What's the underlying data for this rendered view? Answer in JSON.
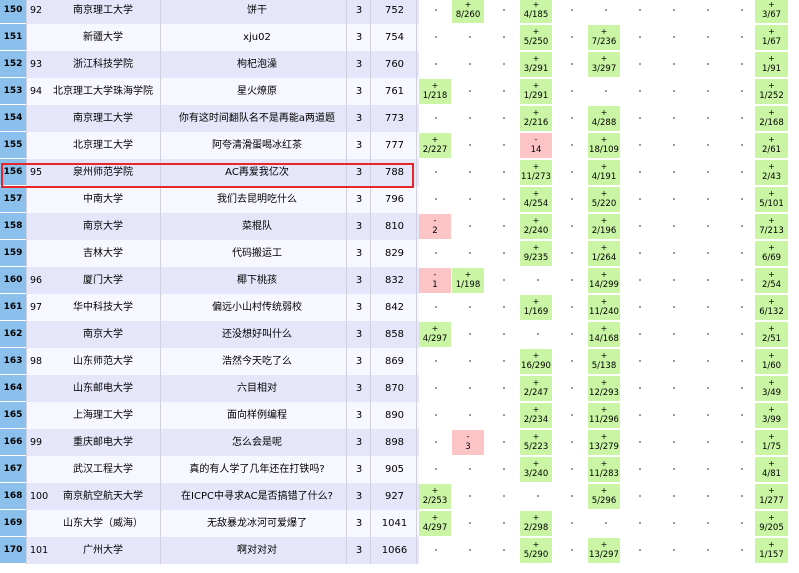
{
  "columns": 15,
  "rows": [
    {
      "rank": "150",
      "school_rank": "92",
      "school": "南京理工大学",
      "team": "饼干",
      "solved": "3",
      "penalty": "752",
      "cells": [
        {
          "c": 1,
          "t": "ac",
          "v": "8/260"
        },
        {
          "c": 3,
          "t": "ac",
          "v": "4/185"
        },
        {
          "c": 14,
          "t": "ac",
          "v": "3/67"
        }
      ]
    },
    {
      "rank": "151",
      "school_rank": "",
      "school": "新疆大学",
      "team": "xju02",
      "solved": "3",
      "penalty": "754",
      "cells": [
        {
          "c": 3,
          "t": "ac",
          "v": "5/250"
        },
        {
          "c": 5,
          "t": "ac",
          "v": "7/236"
        },
        {
          "c": 14,
          "t": "ac",
          "v": "1/67"
        }
      ]
    },
    {
      "rank": "152",
      "school_rank": "93",
      "school": "浙江科技学院",
      "team": "枸杞泡澡",
      "solved": "3",
      "penalty": "760",
      "cells": [
        {
          "c": 3,
          "t": "ac",
          "v": "3/291"
        },
        {
          "c": 5,
          "t": "ac",
          "v": "3/297"
        },
        {
          "c": 14,
          "t": "ac",
          "v": "1/91"
        }
      ]
    },
    {
      "rank": "153",
      "school_rank": "94",
      "school": "北京理工大学珠海学院",
      "team": "星火燎原",
      "solved": "3",
      "penalty": "761",
      "cells": [
        {
          "c": 0,
          "t": "ac",
          "v": "1/218"
        },
        {
          "c": 3,
          "t": "ac",
          "v": "1/291"
        },
        {
          "c": 14,
          "t": "ac",
          "v": "1/252"
        }
      ]
    },
    {
      "rank": "154",
      "school_rank": "",
      "school": "南京理工大学",
      "team": "你有这时间翻队名不是再能a两道题",
      "solved": "3",
      "penalty": "773",
      "cells": [
        {
          "c": 3,
          "t": "ac",
          "v": "2/216"
        },
        {
          "c": 5,
          "t": "ac",
          "v": "4/288"
        },
        {
          "c": 14,
          "t": "ac",
          "v": "2/168"
        }
      ]
    },
    {
      "rank": "155",
      "school_rank": "",
      "school": "北京理工大学",
      "team": "阿夸清滑蛋喝冰红茶",
      "solved": "3",
      "penalty": "777",
      "cells": [
        {
          "c": 0,
          "t": "ac",
          "v": "2/227"
        },
        {
          "c": 3,
          "t": "wa",
          "v": "14"
        },
        {
          "c": 5,
          "t": "ac",
          "v": "18/109"
        },
        {
          "c": 14,
          "t": "ac",
          "v": "2/61"
        }
      ]
    },
    {
      "rank": "156",
      "school_rank": "95",
      "school": "泉州师范学院",
      "team": "AC再爱我亿次",
      "solved": "3",
      "penalty": "788",
      "cells": [
        {
          "c": 3,
          "t": "ac",
          "v": "11/273"
        },
        {
          "c": 5,
          "t": "ac",
          "v": "4/191"
        },
        {
          "c": 14,
          "t": "ac",
          "v": "2/43"
        }
      ]
    },
    {
      "rank": "157",
      "school_rank": "",
      "school": "中南大学",
      "team": "我们去昆明吃什么",
      "solved": "3",
      "penalty": "796",
      "cells": [
        {
          "c": 3,
          "t": "ac",
          "v": "4/254"
        },
        {
          "c": 5,
          "t": "ac",
          "v": "5/220"
        },
        {
          "c": 14,
          "t": "ac",
          "v": "5/101"
        }
      ]
    },
    {
      "rank": "158",
      "school_rank": "",
      "school": "南京大学",
      "team": "菜棍队",
      "solved": "3",
      "penalty": "810",
      "cells": [
        {
          "c": 0,
          "t": "wa",
          "v": "2"
        },
        {
          "c": 3,
          "t": "ac",
          "v": "2/240"
        },
        {
          "c": 5,
          "t": "ac",
          "v": "2/196"
        },
        {
          "c": 14,
          "t": "ac",
          "v": "7/213"
        }
      ]
    },
    {
      "rank": "159",
      "school_rank": "",
      "school": "吉林大学",
      "team": "代码搬运工",
      "solved": "3",
      "penalty": "829",
      "cells": [
        {
          "c": 3,
          "t": "ac",
          "v": "9/235"
        },
        {
          "c": 5,
          "t": "ac",
          "v": "1/264"
        },
        {
          "c": 14,
          "t": "ac",
          "v": "6/69"
        }
      ]
    },
    {
      "rank": "160",
      "school_rank": "96",
      "school": "厦门大学",
      "team": "椰下桃孩",
      "solved": "3",
      "penalty": "832",
      "cells": [
        {
          "c": 0,
          "t": "wa",
          "v": "1"
        },
        {
          "c": 1,
          "t": "ac",
          "v": "1/198"
        },
        {
          "c": 5,
          "t": "ac",
          "v": "14/299"
        },
        {
          "c": 14,
          "t": "ac",
          "v": "2/54"
        }
      ]
    },
    {
      "rank": "161",
      "school_rank": "97",
      "school": "华中科技大学",
      "team": "偏远小山村传统弱校",
      "solved": "3",
      "penalty": "842",
      "cells": [
        {
          "c": 3,
          "t": "ac",
          "v": "1/169"
        },
        {
          "c": 5,
          "t": "ac",
          "v": "11/240"
        },
        {
          "c": 14,
          "t": "ac",
          "v": "6/132"
        }
      ]
    },
    {
      "rank": "162",
      "school_rank": "",
      "school": "南京大学",
      "team": "还没想好叫什么",
      "solved": "3",
      "penalty": "858",
      "cells": [
        {
          "c": 0,
          "t": "ac",
          "v": "4/297"
        },
        {
          "c": 5,
          "t": "ac",
          "v": "14/168"
        },
        {
          "c": 14,
          "t": "ac",
          "v": "2/51"
        }
      ]
    },
    {
      "rank": "163",
      "school_rank": "98",
      "school": "山东师范大学",
      "team": "浩然今天吃了么",
      "solved": "3",
      "penalty": "869",
      "cells": [
        {
          "c": 3,
          "t": "ac",
          "v": "16/290"
        },
        {
          "c": 5,
          "t": "ac",
          "v": "5/138"
        },
        {
          "c": 14,
          "t": "ac",
          "v": "1/60"
        }
      ]
    },
    {
      "rank": "164",
      "school_rank": "",
      "school": "山东邮电大学",
      "team": "六目相对",
      "solved": "3",
      "penalty": "870",
      "cells": [
        {
          "c": 3,
          "t": "ac",
          "v": "2/247"
        },
        {
          "c": 5,
          "t": "ac",
          "v": "12/293"
        },
        {
          "c": 14,
          "t": "ac",
          "v": "3/49"
        }
      ]
    },
    {
      "rank": "165",
      "school_rank": "",
      "school": "上海理工大学",
      "team": "面向样例编程",
      "solved": "3",
      "penalty": "890",
      "cells": [
        {
          "c": 3,
          "t": "ac",
          "v": "2/234"
        },
        {
          "c": 5,
          "t": "ac",
          "v": "11/296"
        },
        {
          "c": 14,
          "t": "ac",
          "v": "3/99"
        }
      ]
    },
    {
      "rank": "166",
      "school_rank": "99",
      "school": "重庆邮电大学",
      "team": "怎么会是呢",
      "solved": "3",
      "penalty": "898",
      "cells": [
        {
          "c": 1,
          "t": "wa",
          "v": "3"
        },
        {
          "c": 3,
          "t": "ac",
          "v": "5/223"
        },
        {
          "c": 5,
          "t": "ac",
          "v": "13/279"
        },
        {
          "c": 14,
          "t": "ac",
          "v": "1/75"
        }
      ]
    },
    {
      "rank": "167",
      "school_rank": "",
      "school": "武汉工程大学",
      "team": "真的有人学了几年还在打铁吗?",
      "solved": "3",
      "penalty": "905",
      "cells": [
        {
          "c": 3,
          "t": "ac",
          "v": "3/240"
        },
        {
          "c": 5,
          "t": "ac",
          "v": "11/283"
        },
        {
          "c": 14,
          "t": "ac",
          "v": "4/81"
        }
      ]
    },
    {
      "rank": "168",
      "school_rank": "100",
      "school": "南京航空航天大学",
      "team": "在ICPC中寻求AC是否搞错了什么?",
      "solved": "3",
      "penalty": "927",
      "cells": [
        {
          "c": 0,
          "t": "ac",
          "v": "2/253"
        },
        {
          "c": 5,
          "t": "ac",
          "v": "5/296"
        },
        {
          "c": 14,
          "t": "ac",
          "v": "1/277"
        }
      ]
    },
    {
      "rank": "169",
      "school_rank": "",
      "school": "山东大学（威海）",
      "team": "无敌暴龙冰河可爱爆了",
      "solved": "3",
      "penalty": "1041",
      "cells": [
        {
          "c": 0,
          "t": "ac",
          "v": "4/297"
        },
        {
          "c": 3,
          "t": "ac",
          "v": "2/298"
        },
        {
          "c": 14,
          "t": "ac",
          "v": "9/205"
        }
      ]
    },
    {
      "rank": "170",
      "school_rank": "101",
      "school": "广州大学",
      "team": "啊对对对",
      "solved": "3",
      "penalty": "1066",
      "cells": [
        {
          "c": 3,
          "t": "ac",
          "v": "5/290"
        },
        {
          "c": 5,
          "t": "ac",
          "v": "13/297"
        },
        {
          "c": 14,
          "t": "ac",
          "v": "1/157"
        }
      ]
    }
  ],
  "symbols": {
    "ac": "+",
    "wa": "-"
  },
  "highlighted_rank": "156"
}
